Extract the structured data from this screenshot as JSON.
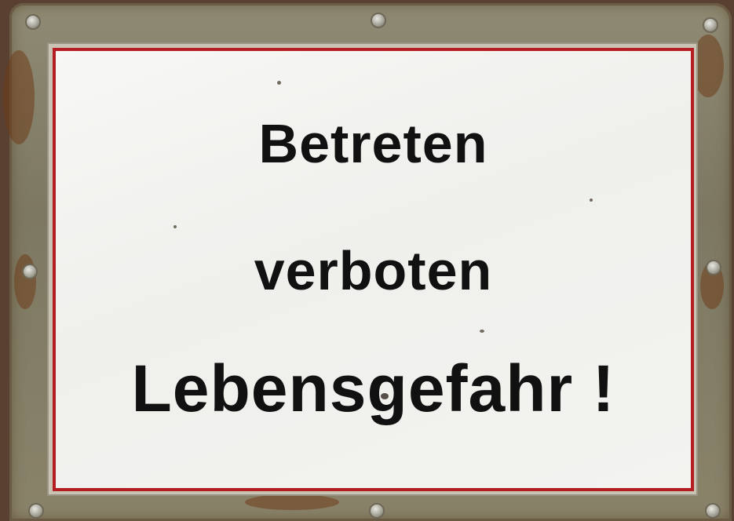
{
  "sign": {
    "line1": "Betreten",
    "line2": "verboten",
    "line3": "Lebensgefahr !"
  },
  "colors": {
    "border_red": "#b41e22",
    "plate_white": "#f3f3f0",
    "frame_metal": "#8a836a",
    "text": "#111111"
  }
}
